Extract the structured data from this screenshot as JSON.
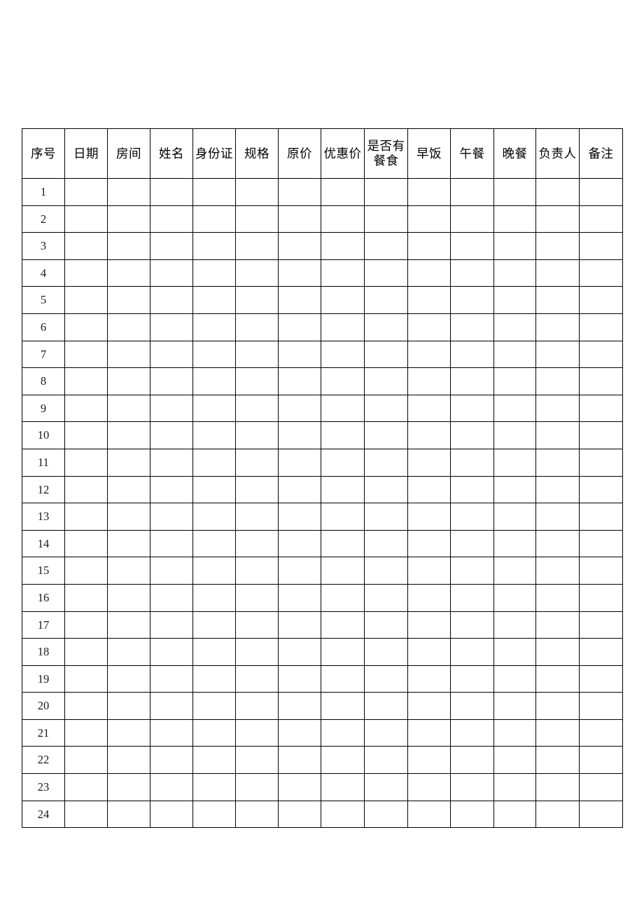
{
  "document": {
    "title": "",
    "background_color": "#ffffff",
    "text_color": "#000000",
    "border_color": "#010101"
  },
  "table": {
    "name": "accommodation-registration-table",
    "column_count": 14,
    "data_row_count": 24,
    "headers": [
      "序号",
      "日期",
      "房间",
      "姓名",
      "身份证",
      "规格",
      "原价",
      "优惠价",
      "是否有餐食",
      "早饭",
      "午餐",
      "晚餐",
      "负责人",
      "备注"
    ],
    "rows": [
      {
        "seq": "1",
        "cells": [
          "",
          "",
          "",
          "",
          "",
          "",
          "",
          "",
          "",
          "",
          "",
          "",
          ""
        ]
      },
      {
        "seq": "2",
        "cells": [
          "",
          "",
          "",
          "",
          "",
          "",
          "",
          "",
          "",
          "",
          "",
          "",
          ""
        ]
      },
      {
        "seq": "3",
        "cells": [
          "",
          "",
          "",
          "",
          "",
          "",
          "",
          "",
          "",
          "",
          "",
          "",
          ""
        ]
      },
      {
        "seq": "4",
        "cells": [
          "",
          "",
          "",
          "",
          "",
          "",
          "",
          "",
          "",
          "",
          "",
          "",
          ""
        ]
      },
      {
        "seq": "5",
        "cells": [
          "",
          "",
          "",
          "",
          "",
          "",
          "",
          "",
          "",
          "",
          "",
          "",
          ""
        ]
      },
      {
        "seq": "6",
        "cells": [
          "",
          "",
          "",
          "",
          "",
          "",
          "",
          "",
          "",
          "",
          "",
          "",
          ""
        ]
      },
      {
        "seq": "7",
        "cells": [
          "",
          "",
          "",
          "",
          "",
          "",
          "",
          "",
          "",
          "",
          "",
          "",
          ""
        ]
      },
      {
        "seq": "8",
        "cells": [
          "",
          "",
          "",
          "",
          "",
          "",
          "",
          "",
          "",
          "",
          "",
          "",
          ""
        ]
      },
      {
        "seq": "9",
        "cells": [
          "",
          "",
          "",
          "",
          "",
          "",
          "",
          "",
          "",
          "",
          "",
          "",
          ""
        ]
      },
      {
        "seq": "10",
        "cells": [
          "",
          "",
          "",
          "",
          "",
          "",
          "",
          "",
          "",
          "",
          "",
          "",
          ""
        ]
      },
      {
        "seq": "11",
        "cells": [
          "",
          "",
          "",
          "",
          "",
          "",
          "",
          "",
          "",
          "",
          "",
          "",
          ""
        ]
      },
      {
        "seq": "12",
        "cells": [
          "",
          "",
          "",
          "",
          "",
          "",
          "",
          "",
          "",
          "",
          "",
          "",
          ""
        ]
      },
      {
        "seq": "13",
        "cells": [
          "",
          "",
          "",
          "",
          "",
          "",
          "",
          "",
          "",
          "",
          "",
          "",
          ""
        ]
      },
      {
        "seq": "14",
        "cells": [
          "",
          "",
          "",
          "",
          "",
          "",
          "",
          "",
          "",
          "",
          "",
          "",
          ""
        ]
      },
      {
        "seq": "15",
        "cells": [
          "",
          "",
          "",
          "",
          "",
          "",
          "",
          "",
          "",
          "",
          "",
          "",
          ""
        ]
      },
      {
        "seq": "16",
        "cells": [
          "",
          "",
          "",
          "",
          "",
          "",
          "",
          "",
          "",
          "",
          "",
          "",
          ""
        ]
      },
      {
        "seq": "17",
        "cells": [
          "",
          "",
          "",
          "",
          "",
          "",
          "",
          "",
          "",
          "",
          "",
          "",
          ""
        ]
      },
      {
        "seq": "18",
        "cells": [
          "",
          "",
          "",
          "",
          "",
          "",
          "",
          "",
          "",
          "",
          "",
          "",
          ""
        ]
      },
      {
        "seq": "19",
        "cells": [
          "",
          "",
          "",
          "",
          "",
          "",
          "",
          "",
          "",
          "",
          "",
          "",
          ""
        ]
      },
      {
        "seq": "20",
        "cells": [
          "",
          "",
          "",
          "",
          "",
          "",
          "",
          "",
          "",
          "",
          "",
          "",
          ""
        ]
      },
      {
        "seq": "21",
        "cells": [
          "",
          "",
          "",
          "",
          "",
          "",
          "",
          "",
          "",
          "",
          "",
          "",
          ""
        ]
      },
      {
        "seq": "22",
        "cells": [
          "",
          "",
          "",
          "",
          "",
          "",
          "",
          "",
          "",
          "",
          "",
          "",
          ""
        ]
      },
      {
        "seq": "23",
        "cells": [
          "",
          "",
          "",
          "",
          "",
          "",
          "",
          "",
          "",
          "",
          "",
          "",
          ""
        ]
      },
      {
        "seq": "24",
        "cells": [
          "",
          "",
          "",
          "",
          "",
          "",
          "",
          "",
          "",
          "",
          "",
          "",
          ""
        ]
      }
    ]
  }
}
